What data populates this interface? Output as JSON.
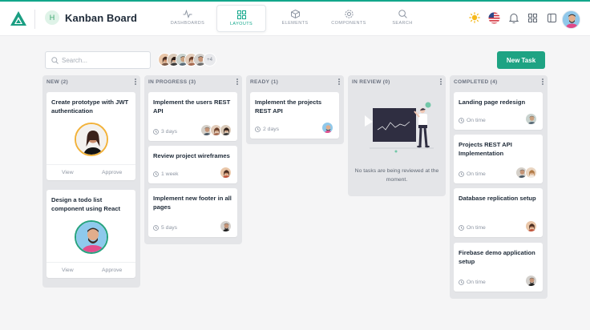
{
  "header": {
    "app_badge": "H",
    "title": "Kanban Board",
    "nav": [
      {
        "label": "DASHBOARDS",
        "icon": "activity-icon"
      },
      {
        "label": "LAYOUTS",
        "icon": "grid-icon",
        "active": true
      },
      {
        "label": "ELEMENTS",
        "icon": "box-icon"
      },
      {
        "label": "COMPONENTS",
        "icon": "settings-icon"
      },
      {
        "label": "SEARCH",
        "icon": "search-icon"
      }
    ],
    "right_icons": [
      "sun-icon",
      "us-flag-icon",
      "bell-icon",
      "apps-grid-icon",
      "sidebar-toggle-icon",
      "user-avatar"
    ]
  },
  "toolbar": {
    "search_placeholder": "Search...",
    "team_more": "+4",
    "new_task_label": "New Task"
  },
  "colors": {
    "accent": "#1ea383",
    "background": "#f5f5f6",
    "column_bg": "#e4e5e8"
  },
  "columns": [
    {
      "title": "NEW (2)",
      "cards": [
        {
          "title": "Create prototype with JWT authentication",
          "view": "View",
          "approve": "Approve"
        },
        {
          "title": "Design a todo list component using React",
          "view": "View",
          "approve": "Approve"
        }
      ]
    },
    {
      "title": "IN PROGRESS (3)",
      "cards": [
        {
          "title": "Implement the users REST API",
          "meta": "3 days"
        },
        {
          "title": "Review project wireframes",
          "meta": "1 week"
        },
        {
          "title": "Implement new footer in all pages",
          "meta": "5 days"
        }
      ]
    },
    {
      "title": "READY (1)",
      "cards": [
        {
          "title": "Implement the projects REST API",
          "meta": "2 days"
        }
      ]
    },
    {
      "title": "IN REVIEW (0)",
      "empty_message": "No tasks are being reviewed at the moment."
    },
    {
      "title": "COMPLETED (4)",
      "cards": [
        {
          "title": "Landing page redesign",
          "meta": "On time"
        },
        {
          "title": "Projects REST API Implementation",
          "meta": "On time"
        },
        {
          "title": "Database replication setup",
          "meta": "On time"
        },
        {
          "title": "Firebase demo application setup",
          "meta": "On time"
        }
      ]
    }
  ]
}
